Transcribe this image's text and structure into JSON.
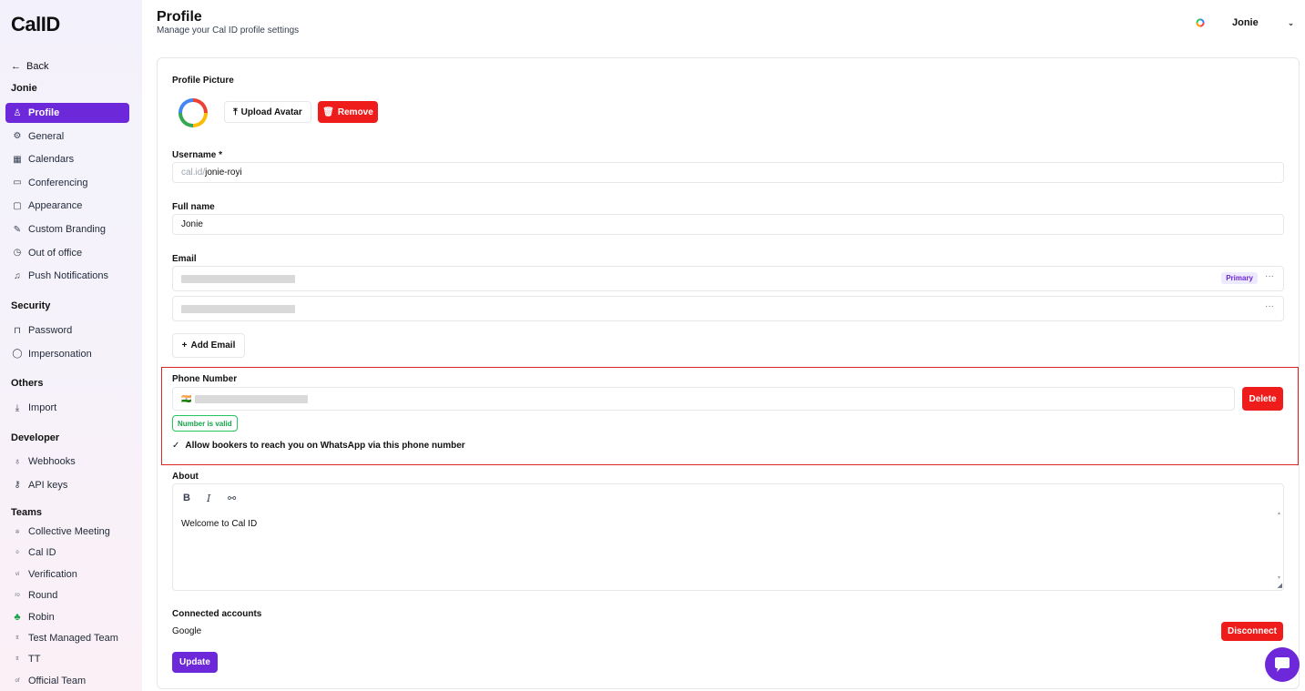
{
  "sidebar": {
    "logo": "CalID",
    "back_label": "Back",
    "user_heading": "Jonie",
    "items": [
      {
        "label": "Profile",
        "icon": "user-icon",
        "glyph": "♙"
      },
      {
        "label": "General",
        "icon": "gear-icon",
        "glyph": "⚙"
      },
      {
        "label": "Calendars",
        "icon": "calendar-icon",
        "glyph": "▦"
      },
      {
        "label": "Conferencing",
        "icon": "video-icon",
        "glyph": "▭"
      },
      {
        "label": "Appearance",
        "icon": "monitor-icon",
        "glyph": "▢"
      },
      {
        "label": "Custom Branding",
        "icon": "brush-icon",
        "glyph": "✎"
      },
      {
        "label": "Out of office",
        "icon": "clock-icon",
        "glyph": "◷"
      },
      {
        "label": "Push Notifications",
        "icon": "bell-icon",
        "glyph": "♫"
      }
    ],
    "security_heading": "Security",
    "security_items": [
      {
        "label": "Password",
        "icon": "lock-icon",
        "glyph": "⊓"
      },
      {
        "label": "Impersonation",
        "icon": "shield-icon",
        "glyph": "◯"
      }
    ],
    "others_heading": "Others",
    "others_items": [
      {
        "label": "Import",
        "icon": "download-icon",
        "glyph": "⤓"
      }
    ],
    "developer_heading": "Developer",
    "developer_items": [
      {
        "label": "Webhooks",
        "icon": "webhook-icon",
        "glyph": "♁"
      },
      {
        "label": "API keys",
        "icon": "key-icon",
        "glyph": "⚷"
      }
    ],
    "teams_heading": "Teams",
    "teams": [
      {
        "label": "Collective Meeting",
        "icon": "team-collective-icon",
        "glyph": "✲"
      },
      {
        "label": "Cal ID",
        "icon": "team-calid-icon",
        "glyph": "o"
      },
      {
        "label": "Verification",
        "icon": "team-verification-icon",
        "glyph": "vi"
      },
      {
        "label": "Round",
        "icon": "team-round-icon",
        "glyph": "ro"
      },
      {
        "label": "Robin",
        "icon": "team-robin-icon",
        "glyph": "♣"
      },
      {
        "label": "Test Managed Team",
        "icon": "team-test-icon",
        "glyph": "tt"
      },
      {
        "label": "TT",
        "icon": "team-tt-icon",
        "glyph": "tt"
      },
      {
        "label": "Official Team",
        "icon": "team-official-icon",
        "glyph": "of"
      }
    ]
  },
  "header": {
    "title": "Profile",
    "subtitle": "Manage your Cal ID profile settings",
    "user_name": "Jonie"
  },
  "profile": {
    "picture_label": "Profile Picture",
    "upload_label": "Upload Avatar",
    "remove_label": "Remove",
    "username_label": "Username *",
    "username_prefix": "cal.id/",
    "username_value": "jonie-royi",
    "fullname_label": "Full name",
    "fullname_value": "Jonie",
    "email_label": "Email",
    "primary_badge": "Primary",
    "more_label": "···",
    "add_email_label": "Add Email",
    "phone_label": "Phone Number",
    "phone_flag": "🇮🇳",
    "delete_label": "Delete",
    "valid_label": "Number is valid",
    "whatsapp_label": "Allow bookers to reach you on WhatsApp via this phone number",
    "about_label": "About",
    "about_text": "Welcome to Cal ID",
    "connected_label": "Connected accounts",
    "connected_provider": "Google",
    "disconnect_label": "Disconnect",
    "update_label": "Update"
  },
  "colors": {
    "brand": "#6d28d9",
    "danger": "#ef1c1c",
    "success": "#16a34a",
    "highlight_border": "#dc2626"
  }
}
